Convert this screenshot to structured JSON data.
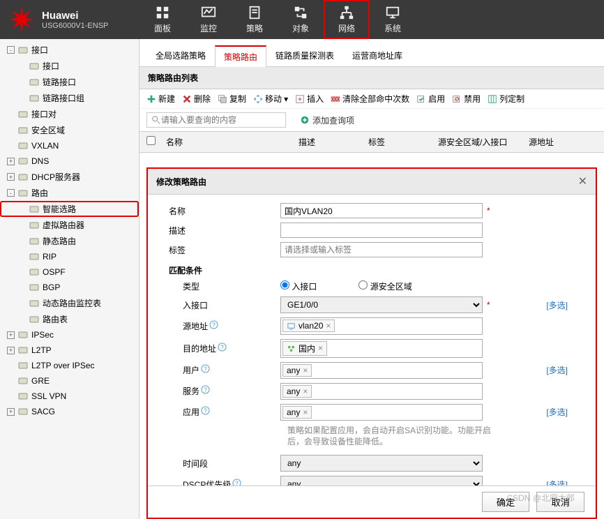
{
  "header": {
    "brand": "Huawei",
    "model": "USG6000V1-ENSP",
    "nav": [
      "面板",
      "监控",
      "策略",
      "对象",
      "网络",
      "系统"
    ],
    "active_nav": 4
  },
  "sidebar": {
    "items": [
      {
        "label": "接口",
        "level": 0,
        "toggle": "-"
      },
      {
        "label": "接口",
        "level": 1
      },
      {
        "label": "链路接口",
        "level": 1
      },
      {
        "label": "链路接口组",
        "level": 1
      },
      {
        "label": "接口对",
        "level": 0
      },
      {
        "label": "安全区域",
        "level": 0
      },
      {
        "label": "VXLAN",
        "level": 0
      },
      {
        "label": "DNS",
        "level": 0,
        "toggle": "+"
      },
      {
        "label": "DHCP服务器",
        "level": 0,
        "toggle": "+"
      },
      {
        "label": "路由",
        "level": 0,
        "toggle": "-"
      },
      {
        "label": "智能选路",
        "level": 1,
        "highlighted": true
      },
      {
        "label": "虚拟路由器",
        "level": 1
      },
      {
        "label": "静态路由",
        "level": 1
      },
      {
        "label": "RIP",
        "level": 1
      },
      {
        "label": "OSPF",
        "level": 1
      },
      {
        "label": "BGP",
        "level": 1
      },
      {
        "label": "动态路由监控表",
        "level": 1
      },
      {
        "label": "路由表",
        "level": 1
      },
      {
        "label": "IPSec",
        "level": 0,
        "toggle": "+"
      },
      {
        "label": "L2TP",
        "level": 0,
        "toggle": "+"
      },
      {
        "label": "L2TP over IPSec",
        "level": 0
      },
      {
        "label": "GRE",
        "level": 0
      },
      {
        "label": "SSL VPN",
        "level": 0
      },
      {
        "label": "SACG",
        "level": 0,
        "toggle": "+"
      }
    ]
  },
  "tabs": [
    "全局选路策略",
    "策略路由",
    "链路质量探测表",
    "运营商地址库"
  ],
  "active_tab": 1,
  "section_title": "策略路由列表",
  "toolbar": {
    "new": "新建",
    "delete": "删除",
    "copy": "复制",
    "move": "移动",
    "insert": "插入",
    "clear": "清除全部命中次数",
    "enable": "启用",
    "disable": "禁用",
    "customize": "列定制"
  },
  "search": {
    "placeholder": "请输入要查询的内容",
    "add_filter": "添加查询项"
  },
  "columns": {
    "name": "名称",
    "desc": "描述",
    "tag": "标签",
    "src_zone": "源安全区域/入接口",
    "src_addr": "源地址"
  },
  "dialog": {
    "title": "修改策略路由",
    "labels": {
      "name": "名称",
      "desc": "描述",
      "tag": "标签",
      "match": "匹配条件",
      "type": "类型",
      "in_iface": "入接口",
      "src_zone": "源安全区域",
      "src_addr": "源地址",
      "dst_addr": "目的地址",
      "user": "用户",
      "service": "服务",
      "app": "应用",
      "period": "时间段",
      "dscp": "DSCP优先级",
      "more": "[多选]"
    },
    "values": {
      "name": "国内VLAN20",
      "tag_placeholder": "请选择或输入标签",
      "type_selected": "in_iface",
      "in_iface": "GE1/0/0",
      "src_addr_chip": "vlan20",
      "dst_addr_chip": "国内",
      "user": "any",
      "service": "any",
      "app": "any",
      "period": "any",
      "dscp": "any"
    },
    "hint": "策略如果配置应用，会自动开启SA识别功能。功能开启后，会导致设备性能降低。",
    "ok": "确定",
    "cancel": "取消"
  },
  "watermark": "CSDN @北府太郎"
}
